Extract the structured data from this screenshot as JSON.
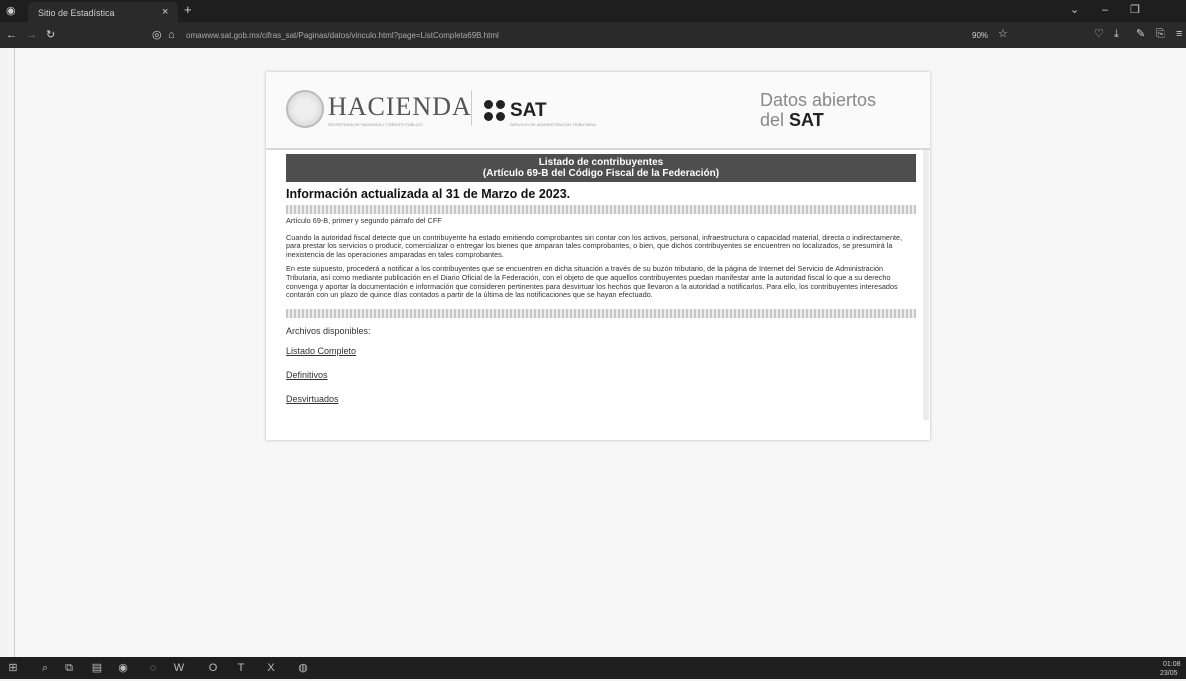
{
  "browser": {
    "tab_title": "Sitio de Estadística",
    "new_tab": "+",
    "close_tab": "×",
    "url": "omawww.sat.gob.mx/cifras_sat/Paginas/datos/vinculo.html?page=ListCompleta69B.html",
    "zoom": "90%",
    "window_controls": [
      "⌄",
      "–",
      "❐"
    ]
  },
  "page": {
    "hacienda": "HACIENDA",
    "hacienda_sub": "SECRETARÍA DE HACIENDA Y CRÉDITO PÚBLICO",
    "sat": "SAT",
    "sat_sub": "SERVICIO DE ADMINISTRACIÓN TRIBUTARIA",
    "datos_1": "Datos abiertos",
    "datos_2a": "del ",
    "datos_2b": "SAT",
    "band_line1": "Listado de contribuyentes",
    "band_line2": "(Artículo 69-B del Código Fiscal de la Federación)",
    "heading": "Información actualizada al 31 de Marzo de 2023.",
    "article_ref": "Artículo 69-B, primer y segundo párrafo del CFF",
    "para1": "Cuando la autoridad fiscal detecte que un contribuyente ha estado emitiendo comprobantes sin contar con los activos, personal, infraestructura o capacidad material, directa o indirectamente, para prestar los servicios o producir, comercializar o entregar los bienes que amparan tales comprobantes, o bien, que dichos contribuyentes se encuentren no localizados, se presumirá la inexistencia de las operaciones amparadas en tales comprobantes.",
    "para2": "En este supuesto, procederá a notificar a los contribuyentes que se encuentren en dicha situación a través de su buzón tributario, de la página de Internet del Servicio de Administración Tributaria, así como mediante publicación en el Diario Oficial de la Federación, con el objeto de que aquellos contribuyentes puedan manifestar ante la autoridad fiscal lo que a su derecho convenga y aportar la documentación e información que consideren pertinentes para desvirtuar los hechos que llevaron a la autoridad a notificarlos. Para ello, los contribuyentes interesados contarán con un plazo de quince días contados a partir de la última de las notificaciones que se hayan efectuado.",
    "archivos": "Archivos disponibles:",
    "links": [
      "Listado Completo",
      "Definitivos",
      "Desvirtuados"
    ]
  },
  "taskbar": {
    "time": "01:08",
    "date": "23/05"
  }
}
